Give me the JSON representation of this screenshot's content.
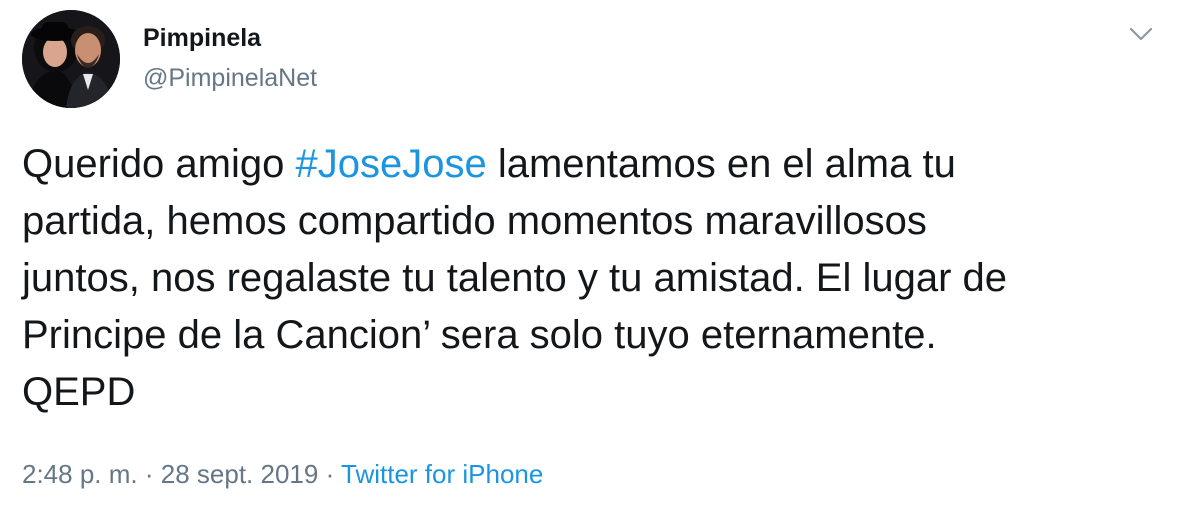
{
  "user": {
    "display_name": "Pimpinela",
    "handle": "@PimpinelaNet"
  },
  "menu": {
    "icon": "chevron-down-icon"
  },
  "tweet": {
    "line1_pre": "Querido amigo ",
    "hashtag": "#JoseJose",
    "line1_post": " lamentamos en el alma tu",
    "line2": "partida, hemos compartido momentos maravillosos",
    "line3": "juntos, nos regalaste tu talento y tu amistad. El lugar de",
    "line4": "Principe de la Cancion’ sera solo tuyo eternamente.",
    "line5": "QEPD"
  },
  "meta": {
    "time": "2:48 p. m.",
    "separator": "·",
    "date": "28 sept. 2019",
    "source": "Twitter for iPhone"
  },
  "colors": {
    "link": "#1b95e0",
    "secondary_text": "#657786",
    "primary_text": "#14171a"
  }
}
